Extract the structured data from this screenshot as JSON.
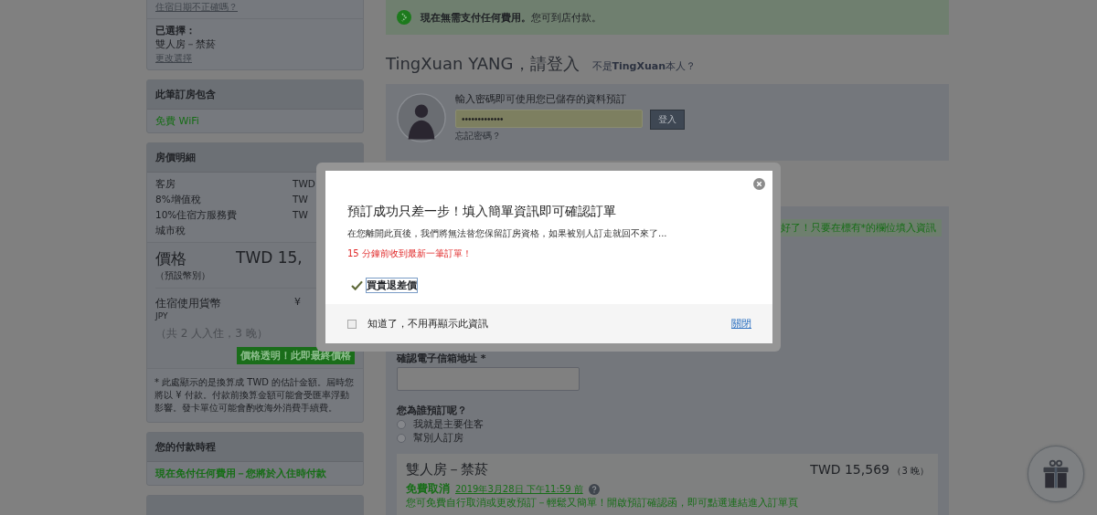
{
  "sidebar": {
    "stay_card": {
      "date_link": "住宿日期不正確嗎？",
      "selected_label": "已選擇：",
      "selected_room": "雙人房－禁菸",
      "change_link": "更改選擇"
    },
    "included_card": {
      "title": "此筆訂房包含",
      "items": [
        "免費 WiFi"
      ]
    },
    "price_card": {
      "title": "房價明細",
      "rows": [
        {
          "label": "客房",
          "value": "TWD"
        },
        {
          "label": "8%增值稅",
          "value": "TW"
        },
        {
          "label": "10%住宿方服務費",
          "value": "TW"
        },
        {
          "label": "城市稅",
          "value": ""
        }
      ],
      "price_label": "價格",
      "price_sub": "（預設幣別）",
      "price_value": "TWD 15,",
      "currency_label": "住宿使用貨幣",
      "currency_code": "JPY",
      "currency_value": "¥",
      "guests": "（共 2 人入住，3 晚）",
      "badge": "價格透明！此即最終價格",
      "note": "* 此處顯示的是換算成 TWD 的估計金額。屆時您將以 ¥ 付款。付款前換算金額可能會受匯率浮動影響。發卡單位可能會酌收海外消費手續費。"
    },
    "payment_card": {
      "title": "您的付款時程",
      "text": "現在免付任何費用－您將於入住時付款"
    }
  },
  "main": {
    "banner": "**現在無需支付任何費用。**您可到店付款。",
    "login": {
      "heading": "TingXuan YANG，請登入",
      "not_me": "不是**TingXuan**本人？",
      "prompt": "輸入密碼即可使用您已儲存的資料預訂",
      "password": "•••••••••••••",
      "button": "登入",
      "forgot": "忘記密碼？"
    },
    "notice": "好了！只要在標有*的欄位填入資訊",
    "email_confirm_label": "確認電子信箱地址 *",
    "booker_question": "您為誰預訂呢？",
    "booker_options": [
      {
        "label": "我就是主要住客",
        "selected": false
      },
      {
        "label": "幫別人訂房",
        "selected": false
      }
    ],
    "room": {
      "name": "雙人房－禁菸",
      "price": "TWD 15,569",
      "nights": "（3 晚）",
      "cancel_title": "免費取消",
      "cancel_date": "2019年3月28日 下午11:59 前",
      "cancel_text": "您可免費自行取消或更改預訂－輕鬆又簡單！開啟預訂確認函，即可點選連結進入訂單頁"
    }
  },
  "modal": {
    "title": "預訂成功只差一步！填入簡單資訊即可確認訂單",
    "text": "在您離開此頁後，我們將無法替您保留訂房資格，如果被別人訂走就回不來了...",
    "alert": "15 分鐘前收到最新一筆訂單！",
    "feature": "買貴退差價",
    "dont_show": {
      "label": "知道了，不用再顯示此資訊",
      "checked": false
    },
    "close_link": "關閉"
  }
}
